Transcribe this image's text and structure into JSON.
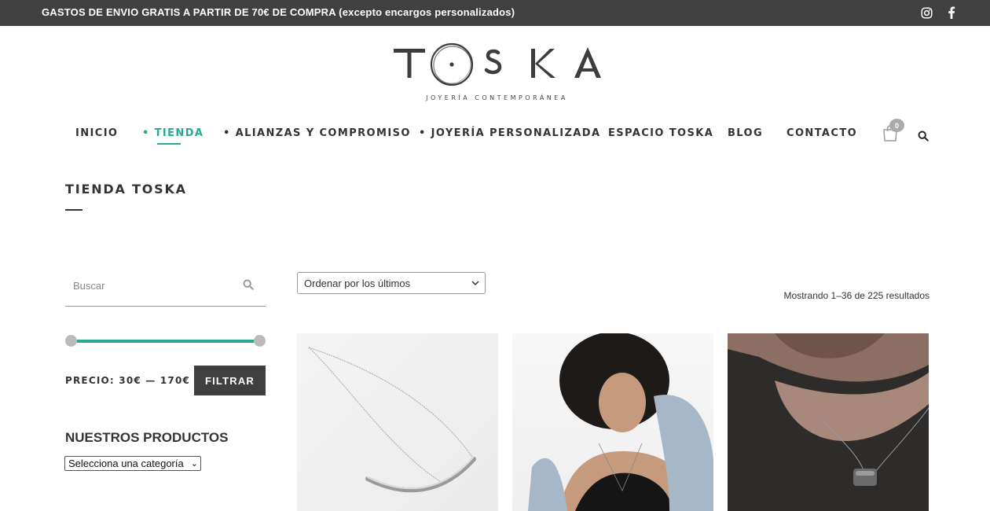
{
  "topbar": {
    "promo": "GASTOS DE ENVIO GRATIS A PARTIR DE 70€ DE COMPRA (excepto encargos personalizados)",
    "social_icons": [
      "instagram-icon",
      "facebook-icon"
    ]
  },
  "logo": {
    "wordmark": "TOSKA",
    "tagline": "JOYERÍA CONTEMPORÁNEA"
  },
  "nav": {
    "items": [
      {
        "label": "INICIO",
        "active": false
      },
      {
        "label": "• TIENDA",
        "active": true
      },
      {
        "label": "• ALIANZAS Y COMPROMISO",
        "active": false
      },
      {
        "label": "• JOYERÍA PERSONALIZADA",
        "active": false
      },
      {
        "label": "ESPACIO TOSKA",
        "active": false
      },
      {
        "label": "BLOG",
        "active": false
      },
      {
        "label": "CONTACTO",
        "active": false
      }
    ],
    "cart_count": "0",
    "accent_color": "#2aa892"
  },
  "page": {
    "title": "TIENDA TOSKA"
  },
  "sidebar": {
    "search_placeholder": "Buscar",
    "price_label": "PRECIO: 30€ — 170€",
    "price_min": 30,
    "price_max": 170,
    "filter_button": "FILTRAR",
    "products_heading": "NUESTROS PRODUCTOS",
    "category_select": "Selecciona una categoría"
  },
  "main": {
    "order_select": "Ordenar por los últimos",
    "results_text": "Mostrando 1–36 de 225 resultados",
    "products": [
      {
        "image": "silver-curved-bar-necklace"
      },
      {
        "image": "model-curly-hair-necklace"
      },
      {
        "image": "man-pendant-necklace"
      }
    ]
  },
  "colors": {
    "topbar_bg": "#404040",
    "accent": "#2aa892",
    "button_bg": "#404040"
  }
}
